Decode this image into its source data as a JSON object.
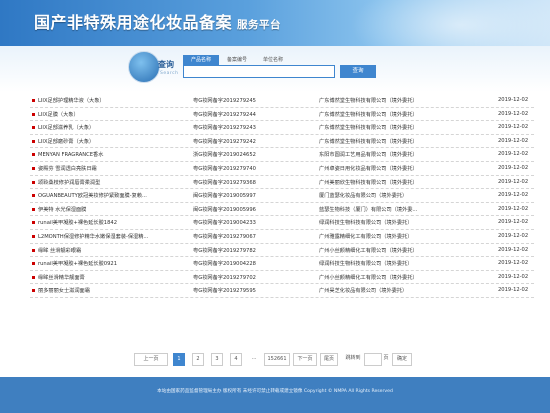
{
  "header": {
    "title": "国产非特殊用途化妆品备案",
    "subtitle": "服务平台"
  },
  "search": {
    "logo_text": "查询",
    "logo_sub": "Search",
    "tabs": [
      "产品名称",
      "备案编号",
      "单位名称"
    ],
    "button_label": "查询",
    "input_value": ""
  },
  "rows": [
    {
      "name": "LIIX足部护理精华液（大象）",
      "no": "粤G妆网备字2019279245",
      "company": "广东博然堂生物科技有限公司（境外委托）",
      "date": "2019-12-02"
    },
    {
      "name": "LIIX足膜（大象）",
      "no": "粤G妆网备字2019279244",
      "company": "广东博然堂生物科技有限公司（境外委托）",
      "date": "2019-12-02"
    },
    {
      "name": "LIIX足部滋养乳（大象）",
      "no": "粤G妆网备字2019279243",
      "company": "广东博然堂生物科技有限公司（境外委托）",
      "date": "2019-12-02"
    },
    {
      "name": "LIIX足部磨砂膏（大象）",
      "no": "粤G妆网备字2019279242",
      "company": "广东博然堂生物科技有限公司（境外委托）",
      "date": "2019-12-02"
    },
    {
      "name": "MENYAN FRAGRANCE香水",
      "no": "浙G妆网备字2019024652",
      "company": "东阳市圆润工艺用品有限公司（境外委托）",
      "date": "2019-12-02"
    },
    {
      "name": "姿殿芬 雪润透白亮肤日霜",
      "no": "粤G妆网备字2019279740",
      "company": "广州卓姿日用化妆品有限公司（境外委托）",
      "date": "2019-12-02"
    },
    {
      "name": "颂聆桑枝修护润唇膏柔润型",
      "no": "粤G妆网备字2019279368",
      "company": "广州美丽欣生物科技有限公司（境外委托）",
      "date": "2019-12-02"
    },
    {
      "name": "OGUANBEAUTY欧冠美妆修护紧致面膜-复赖...",
      "no": "闽G妆网备字2019005997",
      "company": "厦门蓝瑟化妆品有限公司（境外委托）",
      "date": "2019-12-02"
    },
    {
      "name": "伊美特 水光保湿面膜",
      "no": "闽G妆网备字2019005996",
      "company": "蓝瑟生物科技（厦门）有限公司（境外委...",
      "date": "2019-12-02"
    },
    {
      "name": "runail美甲凝胶+裸色延长胶1842",
      "no": "粤G妆网备字2019004233",
      "company": "绿润科技生物科技有限公司（境外委托）",
      "date": "2019-12-02"
    },
    {
      "name": "L2MONTH保湿修护精华水嫩保湿套装-保湿精...",
      "no": "粤G妆网备字2019279067",
      "company": "广州雅露精细化工有限公司（境外委托）",
      "date": "2019-12-02"
    },
    {
      "name": "缘眸 丝滑靓彩眼霜",
      "no": "粤G妆网备字2019279782",
      "company": "广州小丝颜精细化工有限公司（境外委托）",
      "date": "2019-12-02"
    },
    {
      "name": "runail美甲凝胶+裸色延长胶0921",
      "no": "粤G妆网备字2019004228",
      "company": "绿润科技生物科技有限公司（境外委托）",
      "date": "2019-12-02"
    },
    {
      "name": "缘眸丝滑精华靓面膏",
      "no": "粤G妆网备字2019279702",
      "company": "广州小丝颜精细化工有限公司（境外委托）",
      "date": "2019-12-02"
    },
    {
      "name": "丽多丽丽女士滋润面霜",
      "no": "粤G妆网备字2019279595",
      "company": "广州昊芝化妆品有限公司（境外委托）",
      "date": "2019-12-02"
    }
  ],
  "pager": {
    "prev": "上一页",
    "pages": [
      "1",
      "2",
      "3",
      "4",
      "...",
      "152661"
    ],
    "next": "下一页",
    "last": "尾页",
    "jump_label": "跳转到",
    "page_unit": "页",
    "go": "确定"
  },
  "footer": {
    "text": "本站由国家药品监督管理局主办 版权所有 未经许可禁止转载或建立镜像 Copyright © NMPA All Rights Reserved"
  }
}
